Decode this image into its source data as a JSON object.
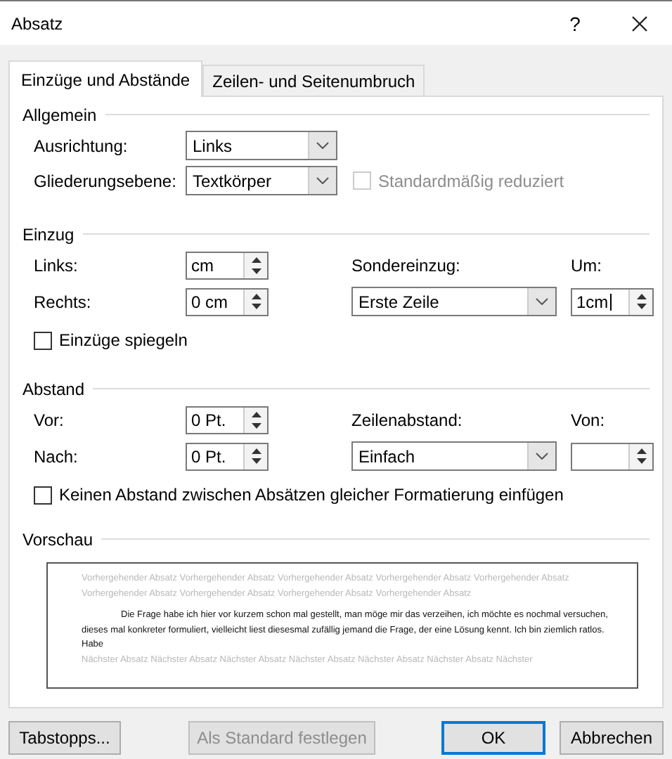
{
  "window": {
    "title": "Absatz",
    "help": "?"
  },
  "tabs": [
    {
      "label": "Einzüge und Abstände",
      "selected": true
    },
    {
      "label": "Zeilen- und Seitenumbruch",
      "selected": false
    }
  ],
  "general": {
    "heading": "Allgemein",
    "alignment": {
      "label": "Ausrichtung:",
      "value": "Links"
    },
    "outline_level": {
      "label": "Gliederungsebene:",
      "value": "Textkörper"
    },
    "collapsed": {
      "label": "Standardmäßig reduziert",
      "checked": false,
      "disabled": true
    }
  },
  "indent": {
    "heading": "Einzug",
    "left": {
      "label": "Links:",
      "value": "cm"
    },
    "right": {
      "label": "Rechts:",
      "value": "0 cm"
    },
    "special": {
      "label": "Sondereinzug:",
      "value": "Erste Zeile"
    },
    "by": {
      "label": "Um:",
      "value": "1cm",
      "focused": true
    },
    "mirror": {
      "label": "Einzüge spiegeln",
      "checked": false
    }
  },
  "spacing": {
    "heading": "Abstand",
    "before": {
      "label": "Vor:",
      "value": "0 Pt."
    },
    "after": {
      "label": "Nach:",
      "value": "0 Pt."
    },
    "line_spacing": {
      "label": "Zeilenabstand:",
      "value": "Einfach"
    },
    "at": {
      "label": "Von:",
      "focused": false
    },
    "no_space": {
      "label": "Keinen Abstand zwischen Absätzen gleicher Formatierung einfügen",
      "checked": false
    }
  },
  "preview": {
    "heading": "Vorschau",
    "previous": "Vorhergehender Absatz Vorhergehender Absatz Vorhergehender Absatz Vorhergehender Absatz Vorhergehender Absatz Vorhergehender Absatz Vorhergehender Absatz Vorhergehender Absatz Vorhergehender Absatz",
    "current": "Die Frage habe ich hier vor kurzem schon mal gestellt, man möge mir das verzeihen, ich möchte es nochmal versuchen, dieses mal konkreter formuliert, vielleicht liest diesesmal zufällig jemand die Frage, der eine Lösung kennt. Ich bin ziemlich ratlos. Habe",
    "next": "Nächster Absatz Nächster Absatz Nächster Absatz Nächster Absatz Nächster Absatz Nächster Absatz Nächster"
  },
  "buttons": [
    {
      "label": "Tabstopps...",
      "kind": "normal"
    },
    {
      "label": "Als Standard festlegen",
      "kind": "disabled"
    },
    {
      "label": "OK",
      "kind": "default"
    },
    {
      "label": "Abbrechen",
      "kind": "normal"
    }
  ]
}
